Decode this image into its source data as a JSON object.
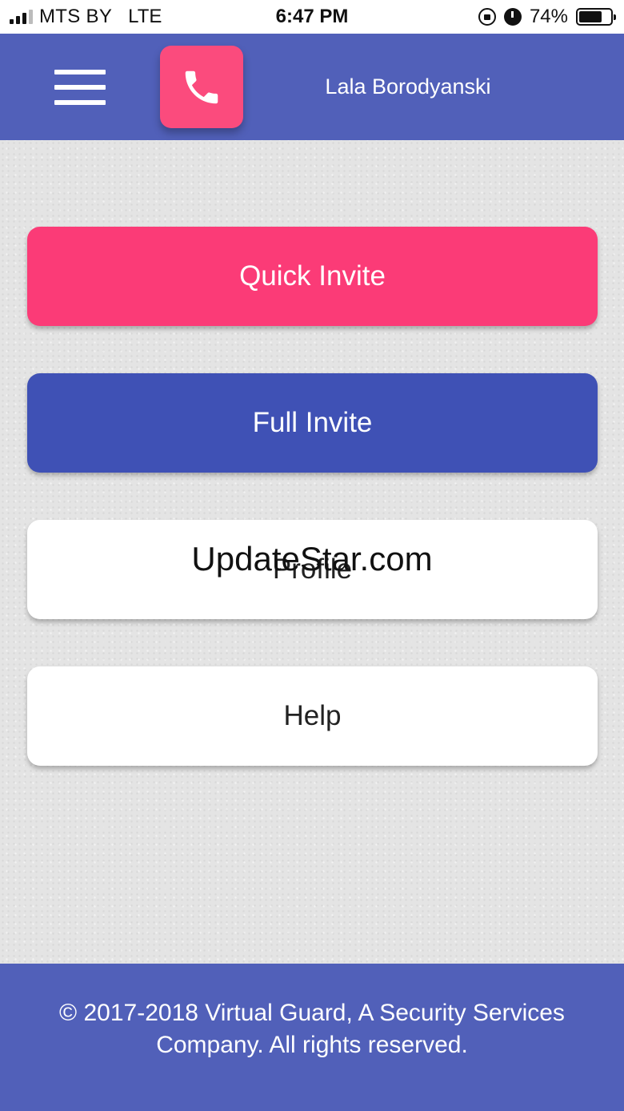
{
  "status_bar": {
    "carrier": "MTS BY",
    "network": "LTE",
    "time": "6:47 PM",
    "battery_percent": "74%",
    "battery_level": 0.74,
    "icons": [
      "signal-icon",
      "rotation-lock-icon",
      "alarm-icon",
      "battery-icon"
    ]
  },
  "header": {
    "menu_icon": "hamburger-menu-icon",
    "call_icon": "phone-icon",
    "user_name": "Lala Borodyanski"
  },
  "main": {
    "buttons": [
      {
        "label": "Quick Invite"
      },
      {
        "label": "Full Invite"
      },
      {
        "label": "Profile"
      },
      {
        "label": "Help"
      }
    ],
    "watermark": "UpdateStar.com"
  },
  "footer": {
    "copyright": "© 2017-2018 Virtual Guard, A Security Services Company. All rights reserved."
  },
  "colors": {
    "header_bg": "#5160b9",
    "quick_invite": "#fb3b77",
    "full_invite": "#3f51b5",
    "call_button": "#fb4b7d",
    "card_white": "#ffffff"
  }
}
